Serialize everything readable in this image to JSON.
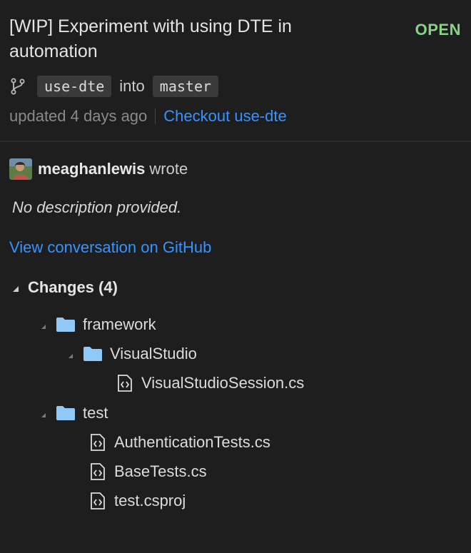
{
  "pull_request": {
    "title": "[WIP] Experiment with using DTE in automation",
    "state": "OPEN",
    "head_branch": "use-dte",
    "into_label": "into",
    "base_branch": "master",
    "updated": "updated 4 days ago",
    "checkout_label": "Checkout use-dte"
  },
  "description": {
    "author": "meaghanlewis",
    "wrote_label": "wrote",
    "text": "No description provided.",
    "view_link": "View conversation on GitHub"
  },
  "changes": {
    "header": "Changes (4)",
    "tree": [
      {
        "type": "folder",
        "label": "framework",
        "expanded": true
      },
      {
        "type": "folder",
        "label": "VisualStudio",
        "expanded": true
      },
      {
        "type": "file",
        "label": "VisualStudioSession.cs"
      },
      {
        "type": "folder",
        "label": "test",
        "expanded": true
      },
      {
        "type": "file",
        "label": "AuthenticationTests.cs"
      },
      {
        "type": "file",
        "label": "BaseTests.cs"
      },
      {
        "type": "file",
        "label": "test.csproj"
      }
    ]
  },
  "colors": {
    "background": "#1e1e1e",
    "open_state": "#89d185",
    "link": "#3794ff",
    "folder": "#90c8f6"
  },
  "icons": [
    "git-branch-icon",
    "avatar",
    "chevron-expanded-icon",
    "folder-icon",
    "code-file-icon"
  ]
}
